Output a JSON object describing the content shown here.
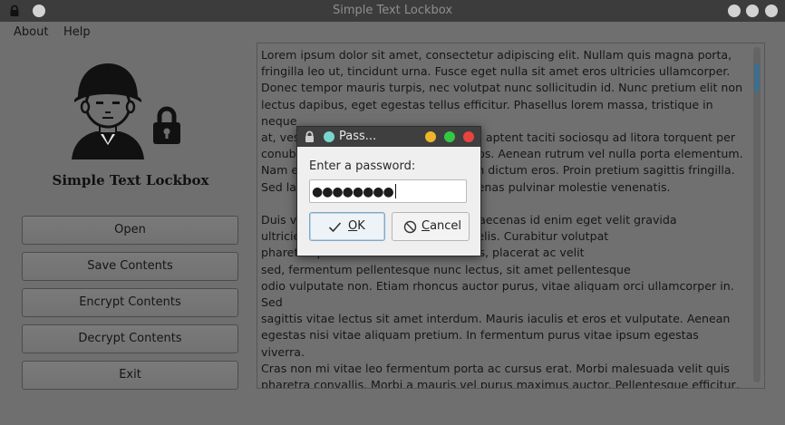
{
  "window": {
    "title": "Simple Text Lockbox"
  },
  "menu": {
    "about": "About",
    "help": "Help"
  },
  "app_name": "Simple Text Lockbox",
  "buttons": {
    "open": "Open",
    "save": "Save Contents",
    "encrypt": "Encrypt Contents",
    "decrypt": "Decrypt Contents",
    "exit": "Exit"
  },
  "editor": {
    "text": "Lorem ipsum dolor sit amet, consectetur adipiscing elit. Nullam quis magna porta,\nfringilla leo ut, tincidunt urna. Fusce eget nulla sit amet eros ultricies ullamcorper.\nDonec tempor mauris turpis, nec volutpat nunc sollicitudin id. Nunc pretium elit non\nlectus dapibus, eget egestas tellus efficitur. Phasellus lorem massa, tristique in neque\nat, vestibulum vestibulum ligula. Class aptent taciti sociosqu ad litora torquent per\nconubia nostra, per inceptos himenaeos. Aenean rutrum vel nulla porta elementum.\nNam et risus et ipsum tincidunt dictum dictum eros. Proin pretium sagittis fringilla.\nSed lacinia id ante vel pharetra. Maecenas pulvinar molestie venenatis.\n\nDuis vehicula mauris sit amet risus. Maecenas id enim eget velit gravida\nultricies in placerat id, rhoncus vitae felis. Curabitur volutpat\npharetra ipsum nec. Praesent ex lectus, placerat ac velit\nsed, fermentum pellentesque nunc lectus, sit amet pellentesque\nodio vulputate non. Etiam rhoncus auctor purus, vitae aliquam orci ullamcorper in. Sed\nsagittis vitae lectus sit amet interdum. Mauris iaculis et eros et vulputate. Aenean\negestas nisi vitae aliquam pretium. In fermentum purus vitae ipsum egestas viverra.\nCras non mi vitae leo fermentum porta ac cursus erat. Morbi malesuada velit quis\npharetra convallis. Morbi a mauris vel purus maximus auctor. Pellentesque efficitur,\nlorem sit amet lobortis condimentum, nibh magna lobortis orci, eu posuere felis tellus\nid lacus."
  },
  "dialog": {
    "title": "Pass...",
    "prompt": "Enter a password:",
    "password_mask": "●●●●●●●●",
    "ok_mnemonic": "O",
    "ok_rest": "K",
    "cancel_mnemonic": "C",
    "cancel_rest": "ancel"
  },
  "colors": {
    "dialog_close": "#e8443f",
    "dialog_minimize": "#f0b429",
    "dialog_maximize": "#32c843",
    "scroll_thumb": "#3d6f8c"
  },
  "icons": {
    "titlebar_lock": "lock-icon",
    "avatar": "soldier-avatar-icon",
    "padlock": "padlock-icon",
    "ok": "checkmark-icon",
    "cancel": "cancel-circle-icon"
  }
}
